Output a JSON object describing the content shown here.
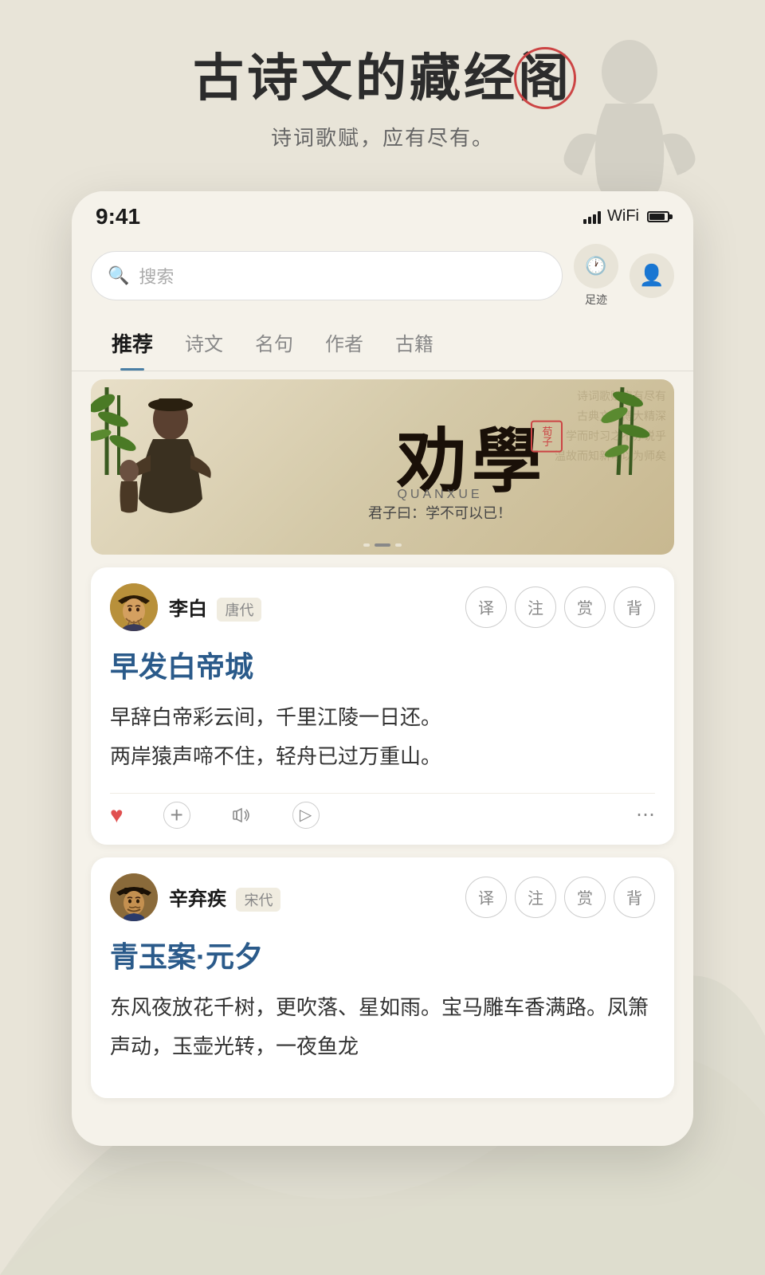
{
  "app": {
    "hero_title_part1": "古诗文的藏经",
    "hero_title_highlight": "阁",
    "hero_subtitle": "诗词歌赋，应有尽有。",
    "status_time": "9:41"
  },
  "toolbar": {
    "search_placeholder": "搜索",
    "history_label": "足迹"
  },
  "nav": {
    "tabs": [
      {
        "label": "推荐",
        "active": true
      },
      {
        "label": "诗文",
        "active": false
      },
      {
        "label": "名句",
        "active": false
      },
      {
        "label": "作者",
        "active": false
      },
      {
        "label": "古籍",
        "active": false
      }
    ]
  },
  "banner": {
    "title": "劝學",
    "subtitle": "QUANXUE",
    "quote": "君子曰：学不可以已！",
    "stamp_text": "荀子"
  },
  "poem1": {
    "poet_name": "李白",
    "poet_dynasty": "唐代",
    "title": "早发白帝城",
    "content_line1": "早辞白帝彩云间，千里江陵一日还。",
    "content_line2": "两岸猿声啼不住，轻舟已过万重山。",
    "action_translate": "译",
    "action_note": "注",
    "action_appreciate": "赏",
    "action_recite": "背"
  },
  "poem2": {
    "poet_name": "辛弃疾",
    "poet_dynasty": "宋代",
    "title": "青玉案·元夕",
    "content": "东风夜放花千树，更吹落、星如雨。宝马雕车香满路。凤箫声动，玉壶光转，一夜鱼龙",
    "action_translate": "译",
    "action_note": "注",
    "action_appreciate": "赏",
    "action_recite": "背"
  },
  "icons": {
    "search": "🔍",
    "history": "🕐",
    "user": "👤",
    "heart": "♥",
    "add": "+",
    "audio": "🔊",
    "next": "▷",
    "more": "⋯",
    "heart_filled": "♥"
  }
}
